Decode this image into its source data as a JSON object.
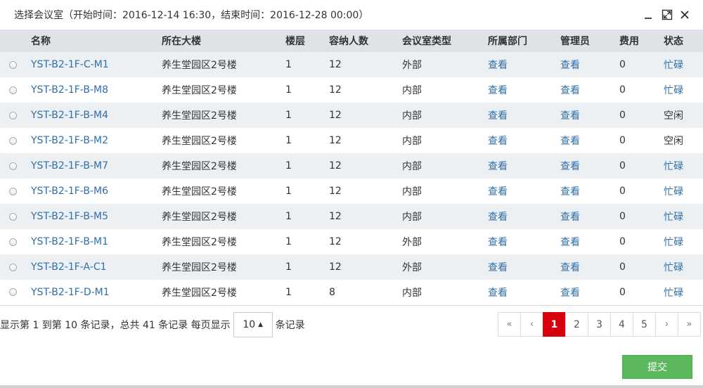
{
  "dialog": {
    "title": "选择会议室（开始时间：2016-12-14 16:30，结束时间：2016-12-28 00:00）"
  },
  "table": {
    "headers": [
      "名称",
      "所在大楼",
      "楼层",
      "容纳人数",
      "会议室类型",
      "所属部门",
      "管理员",
      "费用",
      "状态"
    ],
    "rows": [
      {
        "name": "YST-B2-1F-C-M1",
        "building": "养生堂园区2号楼",
        "floor": "1",
        "capacity": "12",
        "type": "外部",
        "dept": "查看",
        "admin": "查看",
        "fee": "0",
        "status": "忙碌"
      },
      {
        "name": "YST-B2-1F-B-M8",
        "building": "养生堂园区2号楼",
        "floor": "1",
        "capacity": "12",
        "type": "内部",
        "dept": "查看",
        "admin": "查看",
        "fee": "0",
        "status": "忙碌"
      },
      {
        "name": "YST-B2-1F-B-M4",
        "building": "养生堂园区2号楼",
        "floor": "1",
        "capacity": "12",
        "type": "内部",
        "dept": "查看",
        "admin": "查看",
        "fee": "0",
        "status": "空闲"
      },
      {
        "name": "YST-B2-1F-B-M2",
        "building": "养生堂园区2号楼",
        "floor": "1",
        "capacity": "12",
        "type": "内部",
        "dept": "查看",
        "admin": "查看",
        "fee": "0",
        "status": "空闲"
      },
      {
        "name": "YST-B2-1F-B-M7",
        "building": "养生堂园区2号楼",
        "floor": "1",
        "capacity": "12",
        "type": "内部",
        "dept": "查看",
        "admin": "查看",
        "fee": "0",
        "status": "忙碌"
      },
      {
        "name": "YST-B2-1F-B-M6",
        "building": "养生堂园区2号楼",
        "floor": "1",
        "capacity": "12",
        "type": "内部",
        "dept": "查看",
        "admin": "查看",
        "fee": "0",
        "status": "忙碌"
      },
      {
        "name": "YST-B2-1F-B-M5",
        "building": "养生堂园区2号楼",
        "floor": "1",
        "capacity": "12",
        "type": "内部",
        "dept": "查看",
        "admin": "查看",
        "fee": "0",
        "status": "忙碌"
      },
      {
        "name": "YST-B2-1F-B-M1",
        "building": "养生堂园区2号楼",
        "floor": "1",
        "capacity": "12",
        "type": "外部",
        "dept": "查看",
        "admin": "查看",
        "fee": "0",
        "status": "忙碌"
      },
      {
        "name": "YST-B2-1F-A-C1",
        "building": "养生堂园区2号楼",
        "floor": "1",
        "capacity": "12",
        "type": "外部",
        "dept": "查看",
        "admin": "查看",
        "fee": "0",
        "status": "忙碌"
      },
      {
        "name": "YST-B2-1F-D-M1",
        "building": "养生堂园区2号楼",
        "floor": "1",
        "capacity": "8",
        "type": "内部",
        "dept": "查看",
        "admin": "查看",
        "fee": "0",
        "status": "忙碌"
      }
    ]
  },
  "footer": {
    "info_text": "显示第 1 到第 10 条记录，总共 41 条记录 每页显示",
    "page_size": "10",
    "records_suffix": "条记录"
  },
  "pagination": {
    "first": "«",
    "prev": "‹",
    "pages": [
      "1",
      "2",
      "3",
      "4",
      "5"
    ],
    "current": "1",
    "next": "›",
    "last": "»"
  },
  "actions": {
    "submit_label": "提交"
  },
  "colors": {
    "link": "#2f6fa8",
    "active_page": "#d9000d",
    "submit": "#5cb85c",
    "header_bg": "#dfe3e8",
    "odd_row_bg": "#edf0f3"
  }
}
